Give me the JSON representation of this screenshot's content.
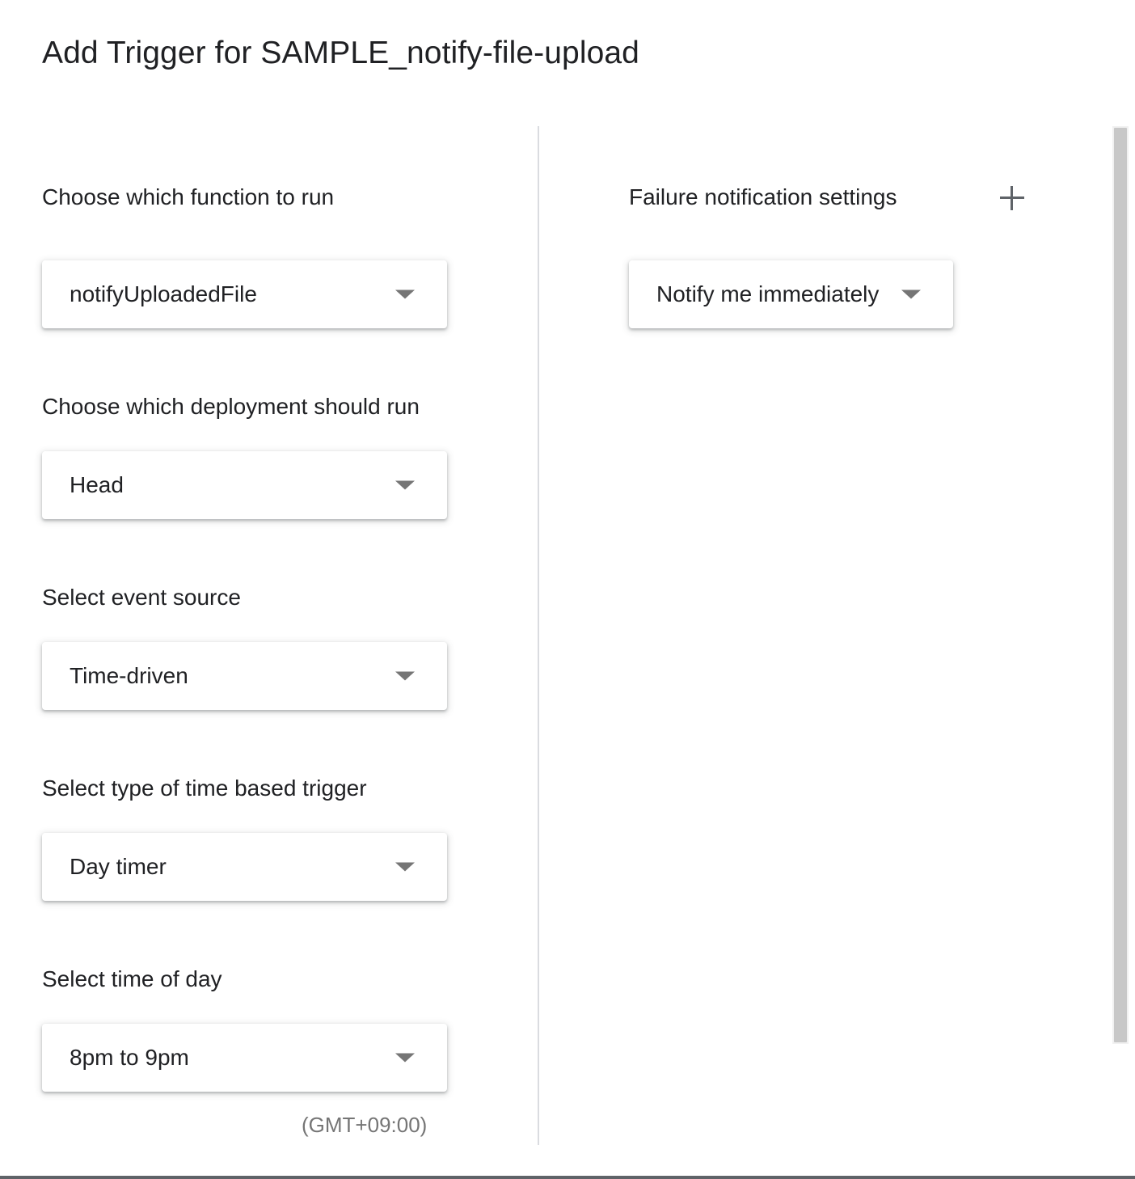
{
  "dialog": {
    "title": "Add Trigger for SAMPLE_notify-file-upload"
  },
  "left_panel": {
    "function": {
      "label": "Choose which function to run",
      "value": "notifyUploadedFile"
    },
    "deployment": {
      "label": "Choose which deployment should run",
      "value": "Head"
    },
    "event_source": {
      "label": "Select event source",
      "value": "Time-driven"
    },
    "time_trigger_type": {
      "label": "Select type of time based trigger",
      "value": "Day timer"
    },
    "time_of_day": {
      "label": "Select time of day",
      "value": "8pm to 9pm",
      "timezone_note": "(GMT+09:00)"
    }
  },
  "right_panel": {
    "failure_notifications": {
      "label": "Failure notification settings",
      "add_icon": "plus-icon",
      "value": "Notify me immediately"
    }
  },
  "icons": {
    "dropdown": "caret-down-icon"
  }
}
